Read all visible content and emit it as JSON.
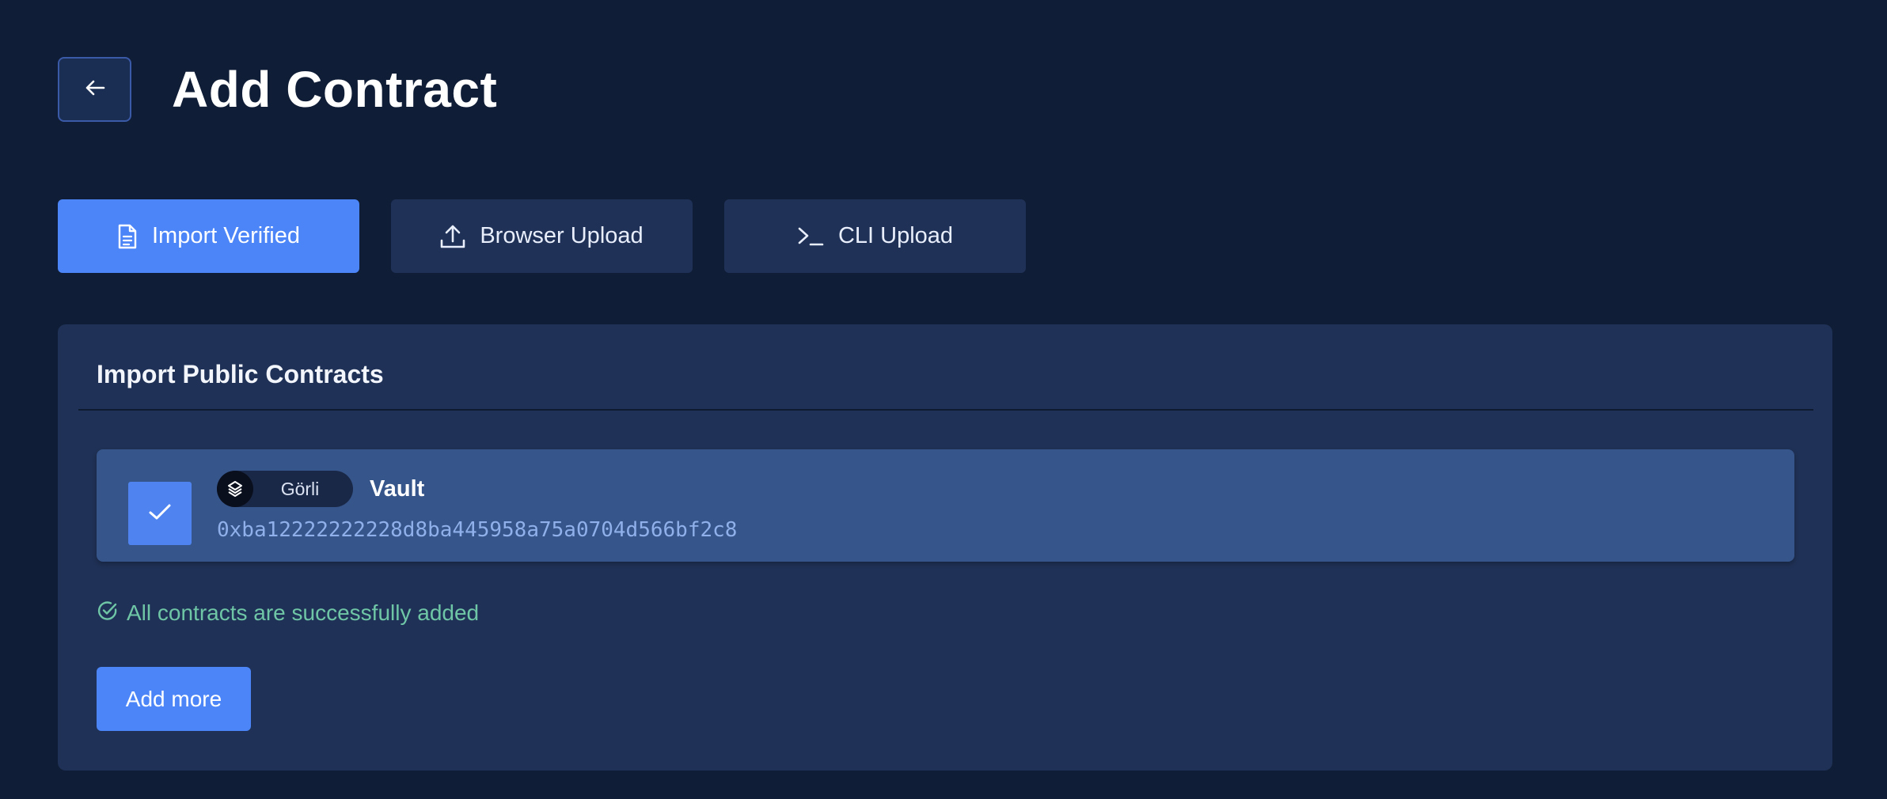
{
  "header": {
    "back_icon": "arrow-left-icon",
    "title": "Add Contract"
  },
  "tabs": [
    {
      "label": "Import Verified",
      "icon": "document-icon",
      "active": true
    },
    {
      "label": "Browser Upload",
      "icon": "upload-icon",
      "active": false
    },
    {
      "label": "CLI Upload",
      "icon": "terminal-icon",
      "active": false
    }
  ],
  "card": {
    "title": "Import Public Contracts",
    "contracts": [
      {
        "checked": true,
        "network": "Görli",
        "network_icon": "ethereum-network-icon",
        "name": "Vault",
        "address": "0xba12222222228d8ba445958a75a0704d566bf2c8"
      }
    ],
    "success_message": "All contracts are successfully added",
    "add_more_label": "Add more"
  },
  "colors": {
    "background": "#101d36",
    "card": "#1f3156",
    "accent": "#4c85f7",
    "success": "#6fc6a6",
    "row_selected": "#36558a"
  }
}
